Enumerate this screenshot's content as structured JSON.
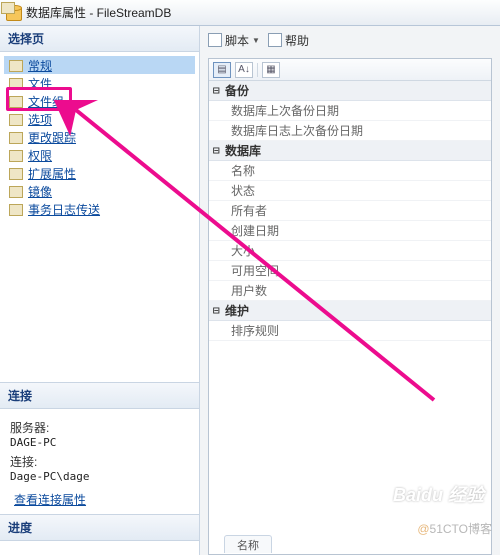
{
  "title": "数据库属性 - FileStreamDB",
  "sidebar": {
    "header": "选择页",
    "items": [
      {
        "label": "常规"
      },
      {
        "label": "文件"
      },
      {
        "label": "文件组"
      },
      {
        "label": "选项"
      },
      {
        "label": "更改跟踪"
      },
      {
        "label": "权限"
      },
      {
        "label": "扩展属性"
      },
      {
        "label": "镜像"
      },
      {
        "label": "事务日志传送"
      }
    ]
  },
  "connection": {
    "header": "连接",
    "server_label": "服务器:",
    "server_value": "DAGE-PC",
    "conn_label": "连接:",
    "conn_value": "Dage-PC\\dage",
    "view_link": "查看连接属性"
  },
  "progress": {
    "header": "进度"
  },
  "toolbar": {
    "script_label": "脚本",
    "help_label": "帮助"
  },
  "grid": {
    "categories": [
      {
        "name": "备份",
        "props": [
          "数据库上次备份日期",
          "数据库日志上次备份日期"
        ]
      },
      {
        "name": "数据库",
        "props": [
          "名称",
          "状态",
          "所有者",
          "创建日期",
          "大小",
          "可用空间",
          "用户数"
        ]
      },
      {
        "name": "维护",
        "props": [
          "排序规则"
        ]
      }
    ]
  },
  "watermark1": "Baidu 经验",
  "watermark2_at": "@",
  "watermark2": "51CTO博客",
  "bottom_tab": "名称"
}
